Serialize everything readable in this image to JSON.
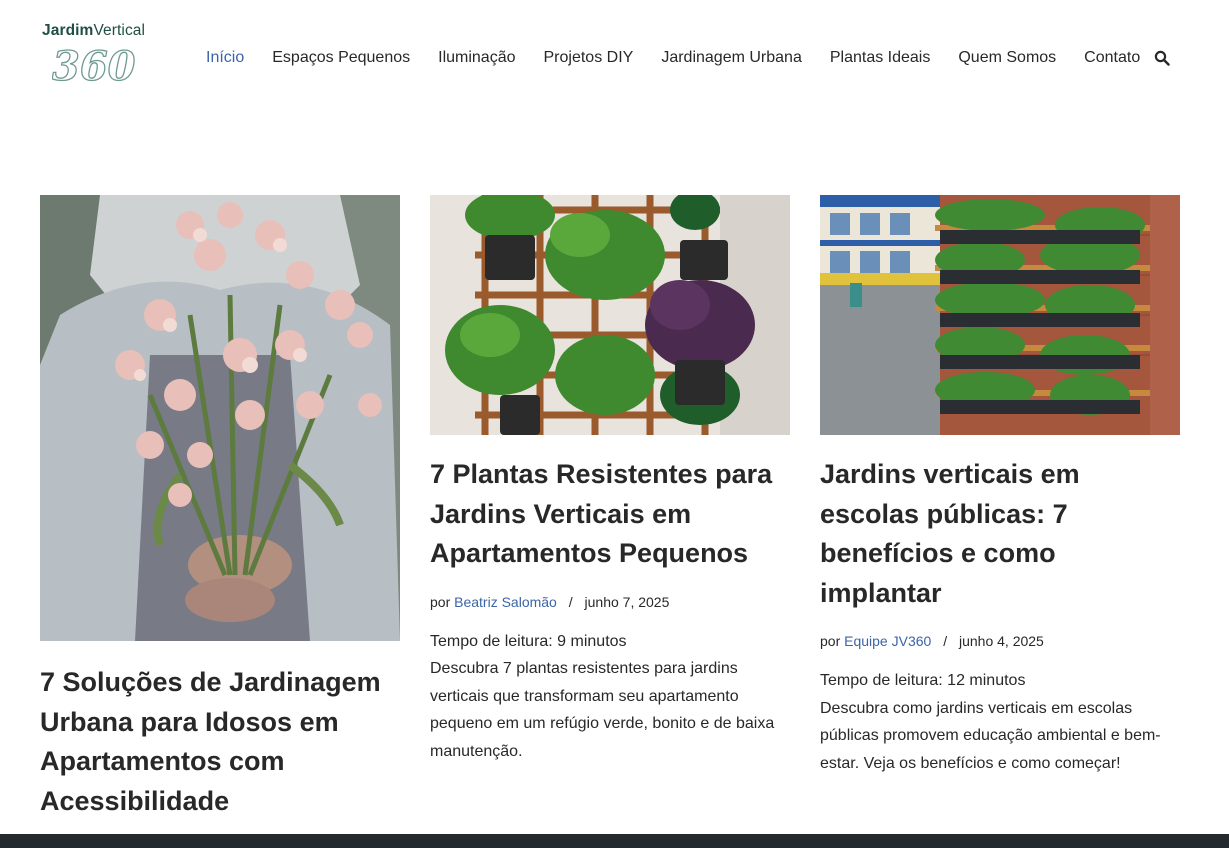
{
  "site": {
    "logo_bold": "Jardim",
    "logo_regular": "Vertical",
    "logo_number": "360",
    "brand_color": "#1f4f44",
    "link_color": "#3b65a7"
  },
  "nav": {
    "items": [
      {
        "label": "Início",
        "active": true
      },
      {
        "label": "Espaços Pequenos"
      },
      {
        "label": "Iluminação"
      },
      {
        "label": "Projetos DIY"
      },
      {
        "label": "Jardinagem Urbana"
      },
      {
        "label": "Plantas Ideais"
      },
      {
        "label": "Quem Somos"
      },
      {
        "label": "Contato"
      }
    ],
    "search_icon": "search-icon"
  },
  "posts": [
    {
      "title": "7 Soluções de Jardinagem Urbana para Idosos em Apartamentos com Acessibilidade",
      "image": "elderly-woman-holding-flowers"
    },
    {
      "title": "7 Plantas Resistentes para Jardins Verticais em Apartamentos Pequenos",
      "by": "por",
      "author": "Beatriz Salomão",
      "sep": "/",
      "date": "junho 7, 2025",
      "reading_time": "Tempo de leitura: 9 minutos",
      "excerpt": "Descubra 7 plantas resistentes para jardins verticais que transformam seu apartamento pequeno em um refúgio verde, bonito e de baixa manutenção.",
      "image": "vertical-garden-trellis"
    },
    {
      "title": "Jardins verticais em escolas públicas: 7 benefícios e como implantar",
      "by": "por",
      "author": "Equipe JV360",
      "sep": "/",
      "date": "junho 4, 2025",
      "reading_time": "Tempo de leitura: 12 minutos",
      "excerpt": "Descubra como jardins verticais em escolas públicas promovem educação ambiental e bem-estar. Veja os benefícios e como começar!",
      "image": "school-vertical-garden-wall"
    }
  ]
}
